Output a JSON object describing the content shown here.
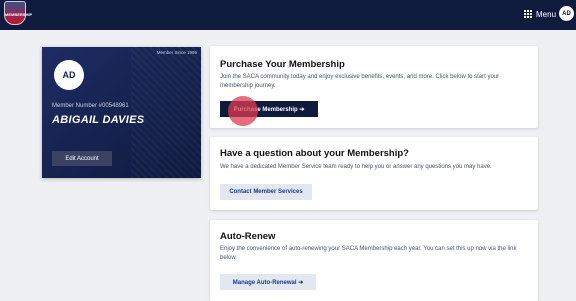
{
  "topbar": {
    "logo_text": "MEMBERSHIP",
    "menu_label": "Menu",
    "user_initials": "AD"
  },
  "member_card": {
    "member_since": "Member Since 1995",
    "initials": "AD",
    "member_number": "Member Number #00548961",
    "name": "ABIGAIL DAVIES",
    "edit_label": "Edit Account"
  },
  "purchase": {
    "title": "Purchase Your Membership",
    "description": "Join the SACA community today and enjoy exclusive benefits, events, and more. Click below to start your membership journey.",
    "button_label": "Purchase Membership ➔"
  },
  "question": {
    "title": "Have a question about your Membership?",
    "description": "We have a dedicated Member Service team ready to help you or answer any questions you may have.",
    "button_label": "Contact Member Services"
  },
  "auto_renew": {
    "title": "Auto-Renew",
    "description": "Enjoy the convenience of auto-renewing your SACA Membership each year. You can set this up now via the link below.",
    "button_label": "Manage Auto-Renewal ➔"
  },
  "colors": {
    "navy": "#0e1b3d",
    "card": "#15224e",
    "click_indicator": "#dc3c50"
  }
}
